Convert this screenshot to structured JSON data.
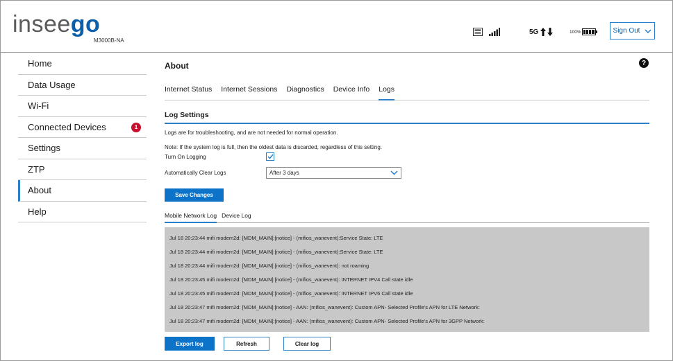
{
  "header": {
    "logo_part1": "insee",
    "logo_part2": "go",
    "model": "M3000B-NA",
    "network": "5G",
    "battery": "100%",
    "sign_out": "Sign Out"
  },
  "sidebar": {
    "items": [
      {
        "label": "Home"
      },
      {
        "label": "Data Usage"
      },
      {
        "label": "Wi-Fi"
      },
      {
        "label": "Connected Devices",
        "badge": "1"
      },
      {
        "label": "Settings"
      },
      {
        "label": "ZTP"
      },
      {
        "label": "About",
        "active": true
      },
      {
        "label": "Help"
      }
    ]
  },
  "main": {
    "title": "About",
    "help": "?",
    "tabs": [
      {
        "label": "Internet Status"
      },
      {
        "label": "Internet Sessions"
      },
      {
        "label": "Diagnostics"
      },
      {
        "label": "Device Info"
      },
      {
        "label": "Logs",
        "active": true
      }
    ],
    "section_title": "Log Settings",
    "info1": "Logs are for troubleshooting, and are not needed for normal operation.",
    "info2": "Note: If the system log is full, then the oldest data is discarded, regardless of this setting.",
    "turn_on_logging_label": "Turn On Logging",
    "turn_on_logging_checked": true,
    "auto_clear_label": "Automatically Clear Logs",
    "auto_clear_value": "After 3 days",
    "save_label": "Save Changes",
    "subtabs": [
      {
        "label": "Mobile Network Log",
        "active": true
      },
      {
        "label": "Device Log"
      }
    ],
    "log_lines": [
      "Jul 18 20:23:44 mifi modem2d: [MDM_MAIN]:[notice] - (mifios_wanevent):Service State: LTE",
      "Jul 18 20:23:44 mifi modem2d: [MDM_MAIN]:[notice] - (mifios_wanevent):Service State: LTE",
      "Jul 18 20:23:44 mifi modem2d: [MDM_MAIN]:[notice] - (mifios_wanevent): not roaming",
      "Jul 18 20:23:45 mifi modem2d: [MDM_MAIN]:[notice] - (mifios_wanevent): INTERNET IPV4 Call state idle",
      "Jul 18 20:23:45 mifi modem2d: [MDM_MAIN]:[notice] - (mifios_wanevent): INTERNET IPV6 Call state idle",
      "Jul 18 20:23:47 mifi modem2d: [MDM_MAIN]:[notice] - AAN: (mifios_wanevent): Custom APN- Selected Profile's APN for LTE Network:",
      "Jul 18 20:23:47 mifi modem2d: [MDM_MAIN]:[notice] - AAN: (mifios_wanevent): Custom APN- Selected Profile's APN for 3GPP Network:"
    ],
    "export_label": "Export log",
    "refresh_label": "Refresh",
    "clear_label": "Clear log"
  },
  "colors": {
    "brand_blue": "#0c5fa8",
    "accent_blue": "#2a7fc9",
    "button_blue": "#0c73c9",
    "badge_red": "#c8102e",
    "log_bg": "#c8c8c8"
  }
}
